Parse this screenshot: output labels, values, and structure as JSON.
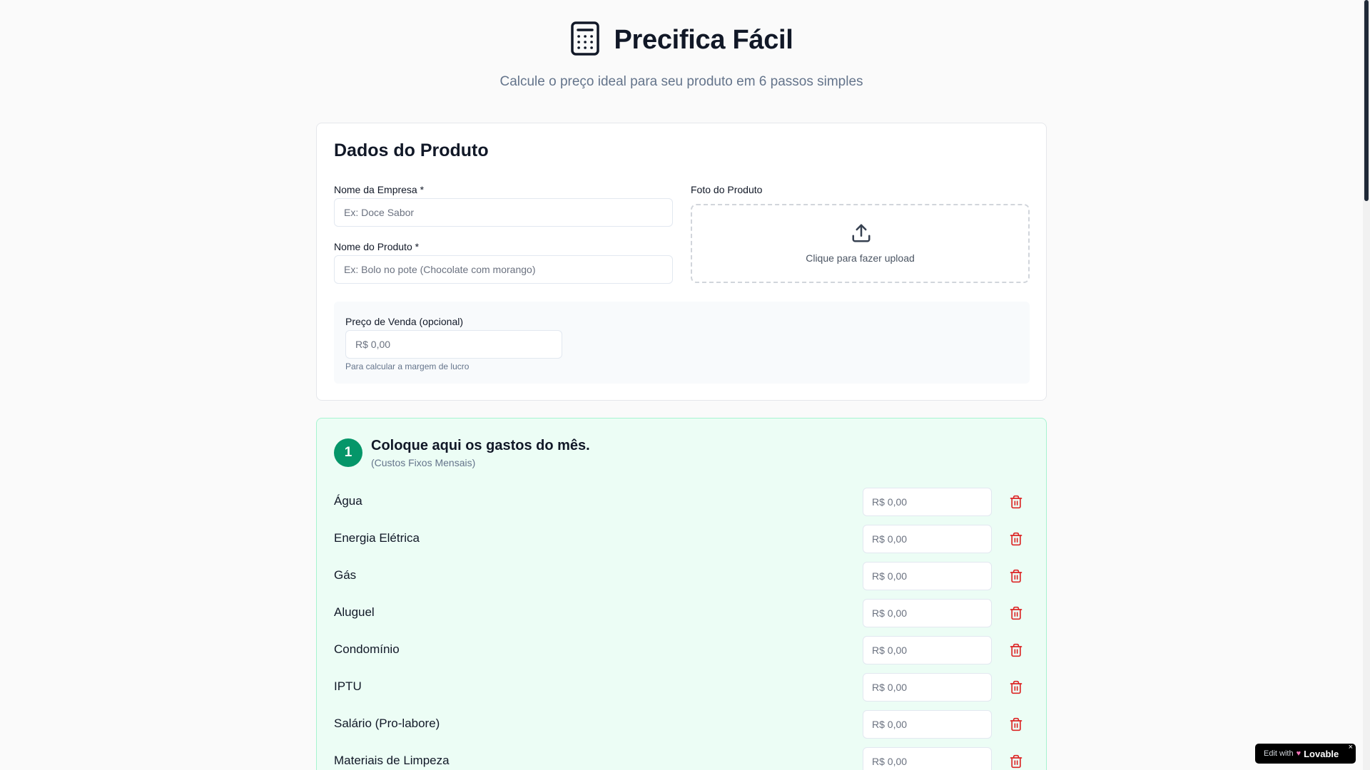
{
  "app": {
    "title": "Precifica Fácil",
    "subtitle": "Calcule o preço ideal para seu produto em 6 passos simples",
    "icon": "calculator-icon"
  },
  "product_card": {
    "title": "Dados do Produto",
    "company_label": "Nome da Empresa *",
    "company_placeholder": "Ex: Doce Sabor",
    "company_value": "",
    "product_label": "Nome do Produto *",
    "product_placeholder": "Ex: Bolo no pote (Chocolate com morango)",
    "product_value": "",
    "photo_label": "Foto do Produto",
    "upload_text": "Clique para fazer upload",
    "price_label": "Preço de Venda (opcional)",
    "price_placeholder": "R$ 0,00",
    "price_value": "",
    "price_hint": "Para calcular a margem de lucro"
  },
  "step1": {
    "number": "1",
    "title": "Coloque aqui os gastos do mês.",
    "subtitle": "(Custos Fixos Mensais)",
    "items": [
      {
        "label": "Água",
        "placeholder": "R$ 0,00",
        "value": ""
      },
      {
        "label": "Energia Elétrica",
        "placeholder": "R$ 0,00",
        "value": ""
      },
      {
        "label": "Gás",
        "placeholder": "R$ 0,00",
        "value": ""
      },
      {
        "label": "Aluguel",
        "placeholder": "R$ 0,00",
        "value": ""
      },
      {
        "label": "Condomínio",
        "placeholder": "R$ 0,00",
        "value": ""
      },
      {
        "label": "IPTU",
        "placeholder": "R$ 0,00",
        "value": ""
      },
      {
        "label": "Salário (Pro-labore)",
        "placeholder": "R$ 0,00",
        "value": ""
      },
      {
        "label": "Materiais de Limpeza",
        "placeholder": "R$ 0,00",
        "value": ""
      }
    ]
  },
  "badge": {
    "edit_text": "Edit with",
    "brand": "Lovable",
    "close": "×"
  },
  "colors": {
    "accent": "#059669",
    "step_bg": "#ecfdf5",
    "delete": "#dc2626",
    "text": "#111827",
    "muted": "#64748b"
  }
}
